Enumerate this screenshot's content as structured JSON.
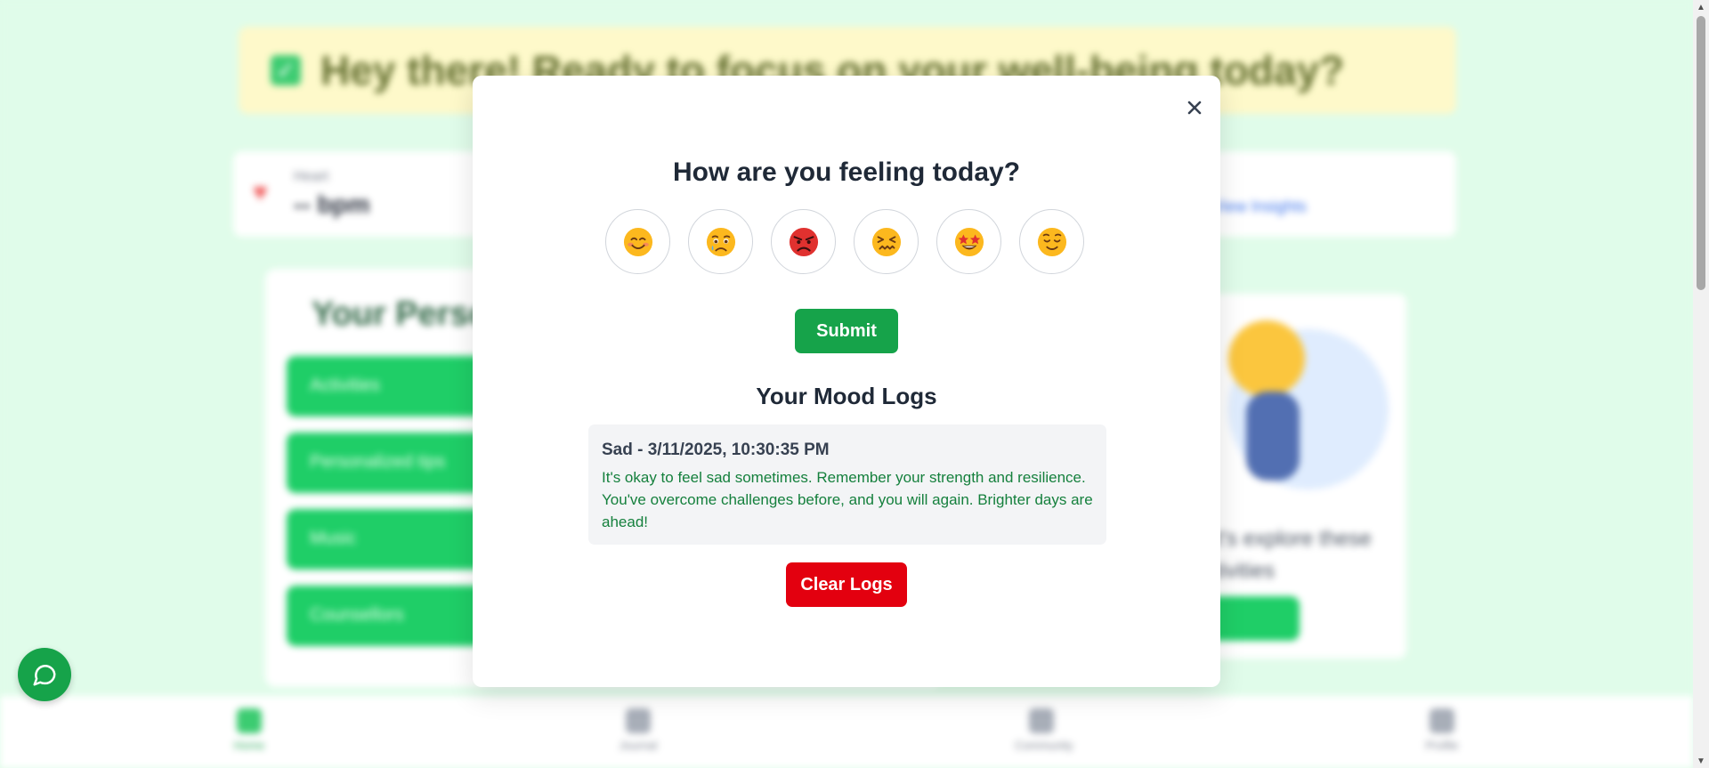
{
  "background": {
    "banner_text": "Hey there! Ready to focus on your well-being today?",
    "stat_label": "Heart",
    "stat_value": "-- bpm",
    "link_text": "View Insights",
    "panel_title": "Your Personalized",
    "recommendations": [
      "Activities",
      "Personalized tips",
      "Music",
      "Counsellors"
    ],
    "panel_text": "Let's explore these activities",
    "nav": [
      "Home",
      "Journal",
      "Community",
      "Profile"
    ]
  },
  "modal": {
    "title": "How are you feeling today?",
    "moods": [
      {
        "name": "happy",
        "icon": "smiling-face-icon"
      },
      {
        "name": "sad",
        "icon": "crying-face-icon"
      },
      {
        "name": "angry",
        "icon": "angry-face-icon"
      },
      {
        "name": "stressed",
        "icon": "confounded-face-icon"
      },
      {
        "name": "excited",
        "icon": "star-struck-face-icon"
      },
      {
        "name": "calm",
        "icon": "relieved-face-icon"
      }
    ],
    "submit_label": "Submit",
    "logs_title": "Your Mood Logs",
    "logs": [
      {
        "heading": "Sad - 3/11/2025, 10:30:35 PM",
        "message": "It's okay to feel sad sometimes. Remember your strength and resilience. You've overcome challenges before, and you will again. Brighter days are ahead!"
      }
    ],
    "clear_label": "Clear Logs"
  },
  "colors": {
    "page_bg": "#dcfce7",
    "primary_green": "#16a34a",
    "danger_red": "#e3000f",
    "log_text_green": "#15803d"
  }
}
